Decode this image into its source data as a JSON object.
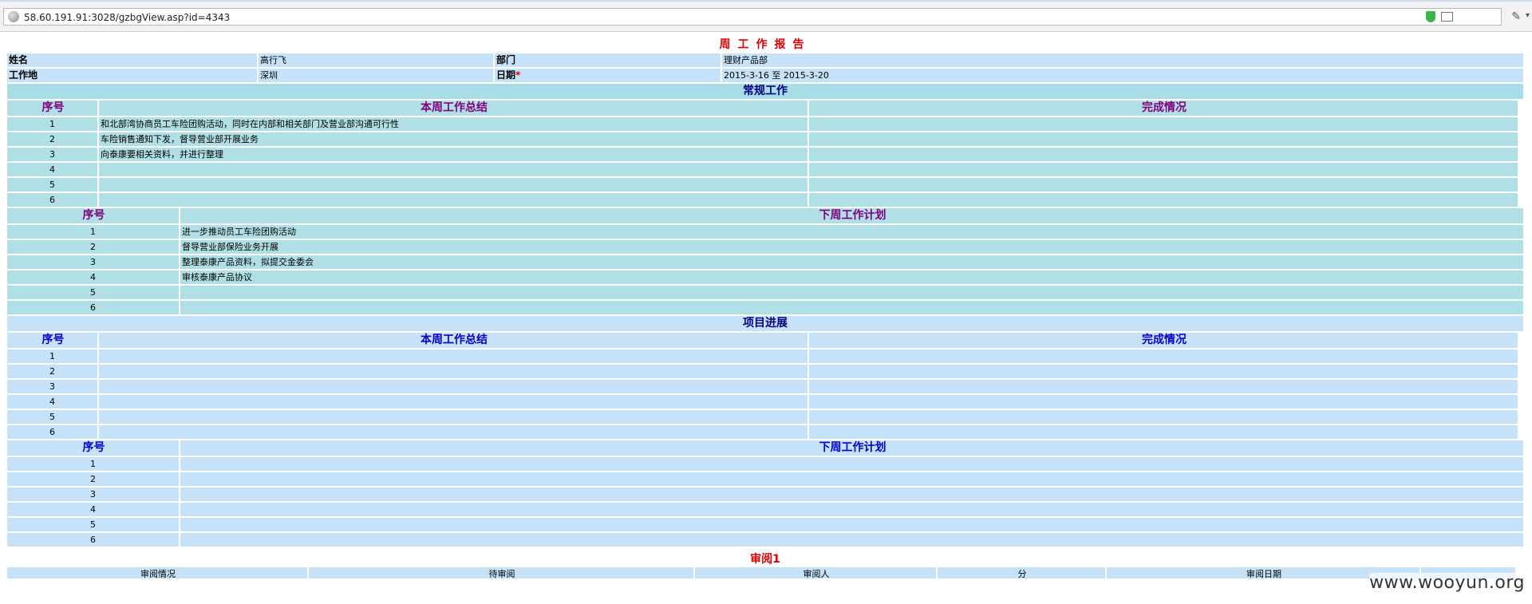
{
  "browser": {
    "url": "58.60.191.91:3028/gzbgView.asp?id=4343"
  },
  "report": {
    "title": "周工作报告",
    "info": {
      "name_label": "姓名",
      "name_value": "高行飞",
      "dept_label": "部门",
      "dept_value": "理财产品部",
      "location_label": "工作地",
      "location_value": "深圳",
      "date_label": "日期",
      "date_required_mark": "*",
      "date_value": "2015-3-16 至 2015-3-20"
    }
  },
  "routine": {
    "section_title": "常规工作",
    "summary_table": {
      "headers": [
        "序号",
        "本周工作总结",
        "完成情况"
      ],
      "rows": [
        {
          "no": "1",
          "summary": "和北部湾协商员工车险团购活动，同时在内部和相关部门及营业部沟通可行性",
          "status": ""
        },
        {
          "no": "2",
          "summary": "车险销售通知下发，督导营业部开展业务",
          "status": ""
        },
        {
          "no": "3",
          "summary": "向泰康要相关资料，并进行整理",
          "status": ""
        },
        {
          "no": "4",
          "summary": "",
          "status": ""
        },
        {
          "no": "5",
          "summary": "",
          "status": ""
        },
        {
          "no": "6",
          "summary": "",
          "status": ""
        }
      ]
    },
    "plan_table": {
      "headers": [
        "序号",
        "下周工作计划"
      ],
      "rows": [
        {
          "no": "1",
          "plan": "进一步推动员工车险团购活动"
        },
        {
          "no": "2",
          "plan": "督导营业部保险业务开展"
        },
        {
          "no": "3",
          "plan": "整理泰康产品资料，拟提交金委会"
        },
        {
          "no": "4",
          "plan": "审核泰康产品协议"
        },
        {
          "no": "5",
          "plan": ""
        },
        {
          "no": "6",
          "plan": ""
        }
      ]
    }
  },
  "project": {
    "section_title": "项目进展",
    "summary_table": {
      "headers": [
        "序号",
        "本周工作总结",
        "完成情况"
      ],
      "rows": [
        {
          "no": "1",
          "summary": "",
          "status": ""
        },
        {
          "no": "2",
          "summary": "",
          "status": ""
        },
        {
          "no": "3",
          "summary": "",
          "status": ""
        },
        {
          "no": "4",
          "summary": "",
          "status": ""
        },
        {
          "no": "5",
          "summary": "",
          "status": ""
        },
        {
          "no": "6",
          "summary": "",
          "status": ""
        }
      ]
    },
    "plan_table": {
      "headers": [
        "序号",
        "下周工作计划"
      ],
      "rows": [
        {
          "no": "1",
          "plan": ""
        },
        {
          "no": "2",
          "plan": ""
        },
        {
          "no": "3",
          "plan": ""
        },
        {
          "no": "4",
          "plan": ""
        },
        {
          "no": "5",
          "plan": ""
        },
        {
          "no": "6",
          "plan": ""
        }
      ]
    }
  },
  "review": {
    "title": "审阅1",
    "headers": [
      "审阅情况",
      "待审阅",
      "审阅人",
      "分",
      "审阅日期",
      ""
    ]
  },
  "watermark": "www.wooyun.org"
}
